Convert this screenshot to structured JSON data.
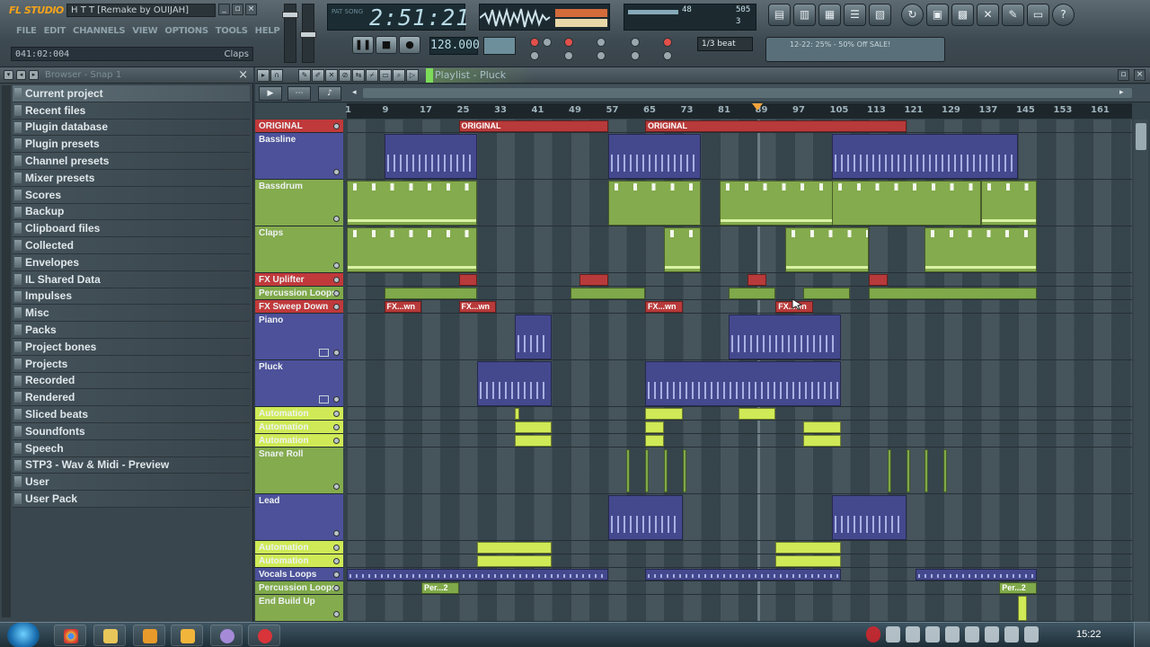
{
  "app": {
    "logo": "FL STUDIO",
    "song_title": "H T T [Remake by OUIJAH]",
    "window_buttons": [
      "_",
      "▫",
      "×"
    ],
    "menu": [
      "FILE",
      "EDIT",
      "CHANNELS",
      "VIEW",
      "OPTIONS",
      "TOOLS",
      "HELP"
    ],
    "hint_position": "041:02:004",
    "hint_text": "Claps"
  },
  "transport": {
    "time_label": "PAT SONG",
    "time": "2:51:21",
    "cpu_value": "48",
    "ram_value": "505",
    "poly_value": "3",
    "tempo": "128.000",
    "snap": "1/3 beat",
    "news": "12-22: 25% - 50% Off SALE!",
    "play_symbol": "❚❚",
    "stop_symbol": "■",
    "record_symbol": "●"
  },
  "toolbar_icons": [
    "playlist-icon",
    "piano-roll-icon",
    "channel-rack-icon",
    "mixer-icon",
    "browser-icon",
    "undo-icon",
    "save-icon",
    "render-icon",
    "settings-icon",
    "tools-icon",
    "export-icon",
    "help-icon"
  ],
  "browser": {
    "title": "Browser - Snap 1",
    "items": [
      "Current project",
      "Recent files",
      "Plugin database",
      "Plugin presets",
      "Channel presets",
      "Mixer presets",
      "Scores",
      "Backup",
      "Clipboard files",
      "Collected",
      "Envelopes",
      "IL Shared Data",
      "Impulses",
      "Misc",
      "Packs",
      "Project bones",
      "Projects",
      "Recorded",
      "Rendered",
      "Sliced beats",
      "Soundfonts",
      "Speech",
      "STP3 - Wav & Midi - Preview",
      "User",
      "User Pack"
    ]
  },
  "playlist": {
    "title": "Playlist - Pluck",
    "ruler_ticks": [
      "1",
      "9",
      "17",
      "25",
      "33",
      "41",
      "49",
      "57",
      "65",
      "73",
      "81",
      "89",
      "97",
      "105",
      "113",
      "121",
      "129",
      "137",
      "145",
      "153",
      "161"
    ],
    "tracks": [
      {
        "name": "ORIGINAL",
        "color": "#c0393b"
      },
      {
        "name": "Bassline",
        "color": "#4c519a"
      },
      {
        "name": "Bassdrum",
        "color": "#84ab4d"
      },
      {
        "name": "Claps",
        "color": "#84ab4d"
      },
      {
        "name": "FX Uplifter",
        "color": "#c0393b"
      },
      {
        "name": "Percussion Loops",
        "color": "#7fa94a"
      },
      {
        "name": "FX Sweep Down",
        "color": "#c0393b"
      },
      {
        "name": "Piano",
        "color": "#4c519a"
      },
      {
        "name": "Pluck",
        "color": "#4c519a"
      },
      {
        "name": "Automation",
        "color": "#cfea56"
      },
      {
        "name": "Automation",
        "color": "#cfea56"
      },
      {
        "name": "Automation",
        "color": "#cfea56"
      },
      {
        "name": "Snare Roll",
        "color": "#84ab4d"
      },
      {
        "name": "Lead",
        "color": "#4c519a"
      },
      {
        "name": "Automation",
        "color": "#cfea56"
      },
      {
        "name": "Automation",
        "color": "#cfea56"
      },
      {
        "name": "Vocals Loops",
        "color": "#4c519a"
      },
      {
        "name": "Percussion Loops",
        "color": "#7fa94a"
      },
      {
        "name": "End Build Up",
        "color": "#84ab4d"
      }
    ],
    "clip_labels": {
      "original": "ORIGINAL",
      "fx_sweep": "FX...wn",
      "perc": "Per...2"
    },
    "playhead_bar": 89
  },
  "taskbar": {
    "clock": "15:22"
  }
}
